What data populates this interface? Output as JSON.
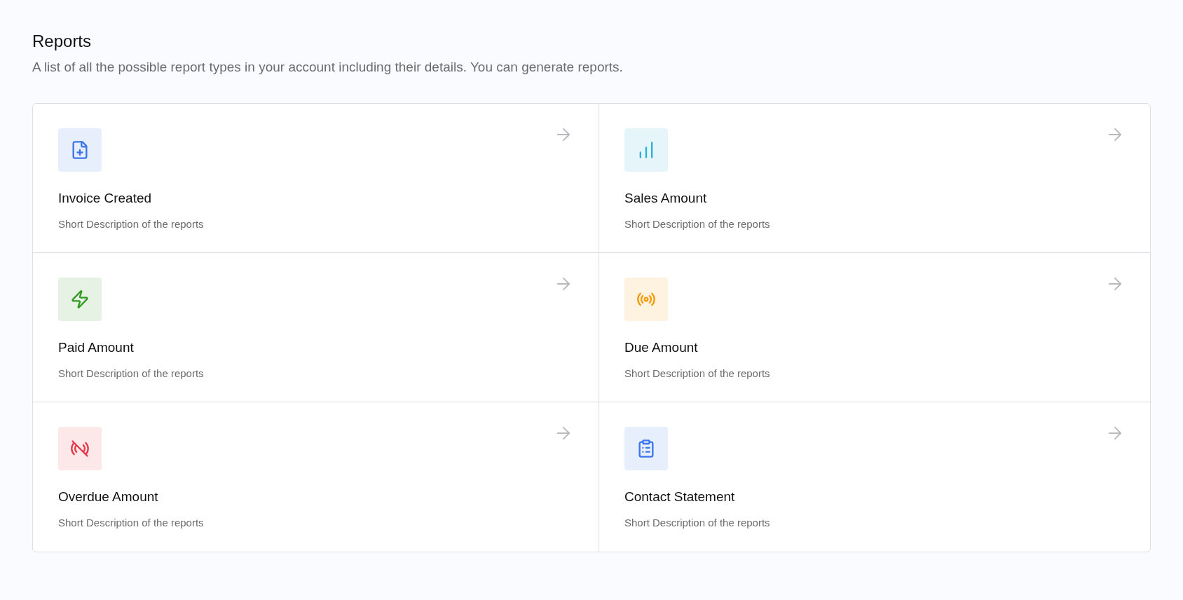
{
  "header": {
    "title": "Reports",
    "description": "A list of all the possible report types in your account including their details. You can generate reports."
  },
  "reports": [
    {
      "title": "Invoice Created",
      "description": "Short Description of the reports",
      "color": "#3b76e8"
    },
    {
      "title": "Sales Amount",
      "description": "Short Description of the reports",
      "color": "#2bb0d6"
    },
    {
      "title": "Paid Amount",
      "description": "Short Description of the reports",
      "color": "#2e9a1e"
    },
    {
      "title": "Due Amount",
      "description": "Short Description of the reports",
      "color": "#f59a0b"
    },
    {
      "title": "Overdue Amount",
      "description": "Short Description of the reports",
      "color": "#e5384a"
    },
    {
      "title": "Contact Statement",
      "description": "Short Description of the reports",
      "color": "#3b76e8"
    }
  ]
}
